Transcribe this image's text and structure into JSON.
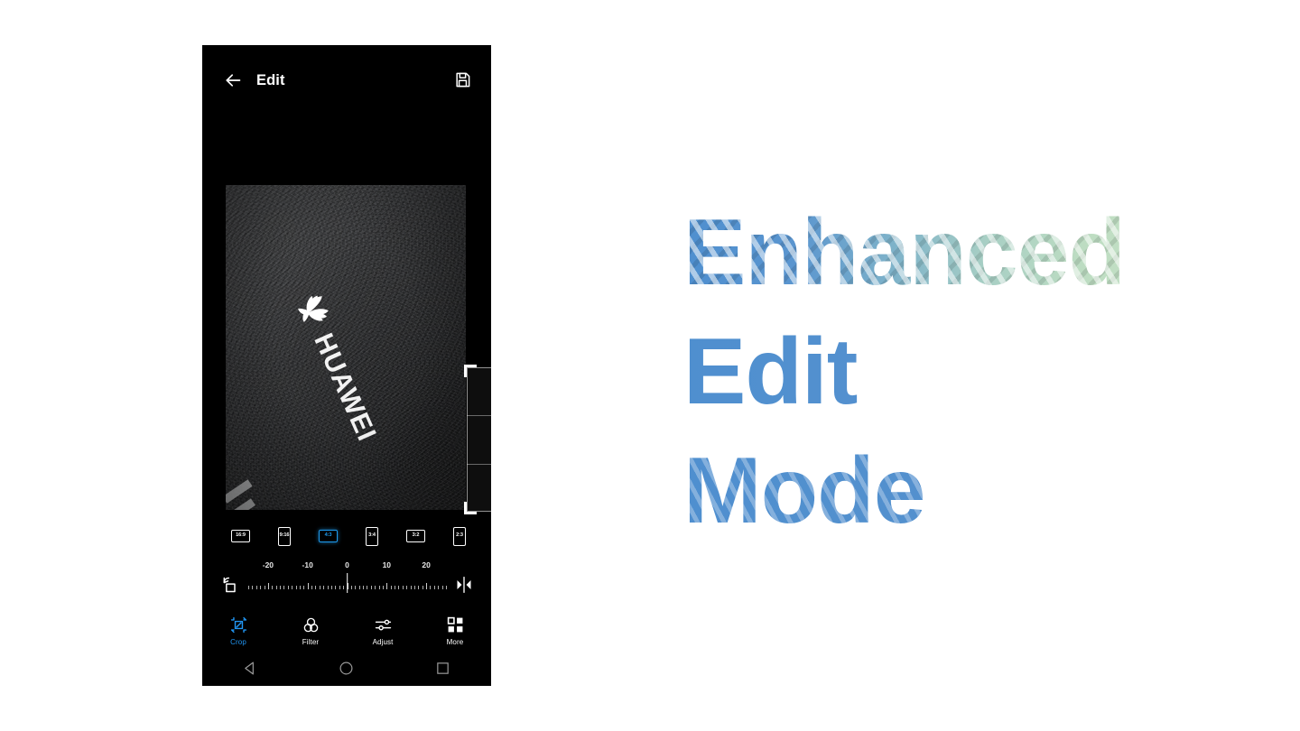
{
  "app": {
    "title": "Edit",
    "back_icon": "back-arrow-icon",
    "save_icon": "save-floppy-icon"
  },
  "photo": {
    "brand_word": "HUAWEI",
    "brand_mark": "huawei-flower-logo",
    "description": "dark textured slate surface with white HUAWEI logo"
  },
  "crop": {
    "overlay_label": "crop-selection",
    "handles": [
      "top-left",
      "top-right",
      "bottom-left",
      "bottom-right"
    ],
    "grid": "rule-of-thirds"
  },
  "ratios": {
    "items": [
      {
        "label": "16:9",
        "orientation": "landscape",
        "selected": false
      },
      {
        "label": "9:16",
        "orientation": "portrait",
        "selected": false
      },
      {
        "label": "4:3",
        "orientation": "landscape",
        "selected": true
      },
      {
        "label": "3:4",
        "orientation": "portrait",
        "selected": false
      },
      {
        "label": "3:2",
        "orientation": "landscape",
        "selected": false
      },
      {
        "label": "2:3",
        "orientation": "portrait",
        "selected": false
      }
    ]
  },
  "rotation": {
    "rotate_icon": "rotate-left-icon",
    "mirror_icon": "mirror-flip-icon",
    "tick_labels": [
      "-20",
      "-10",
      "0",
      "10",
      "20"
    ],
    "min": -25,
    "max": 25,
    "value": 0,
    "unit": "degrees"
  },
  "tools": {
    "tabs": [
      {
        "label": "Crop",
        "icon": "crop-icon",
        "active": true
      },
      {
        "label": "Filter",
        "icon": "filter-icon",
        "active": false
      },
      {
        "label": "Adjust",
        "icon": "sliders-icon",
        "active": false
      },
      {
        "label": "More",
        "icon": "grid-more-icon",
        "active": false
      }
    ]
  },
  "nav": {
    "back": "nav-back-triangle-icon",
    "home": "nav-home-circle-icon",
    "recents": "nav-recents-square-icon"
  },
  "headline": {
    "line1": "Enhanced",
    "line2": "Edit",
    "line3": "Mode"
  },
  "colors": {
    "accent_blue": "#2196f3",
    "chip_selected": "#1e9cf0",
    "headline_blue": "#4f8fcf",
    "headline_green": "#c9e3c6",
    "phone_bg": "#000000",
    "page_bg": "#ffffff"
  }
}
